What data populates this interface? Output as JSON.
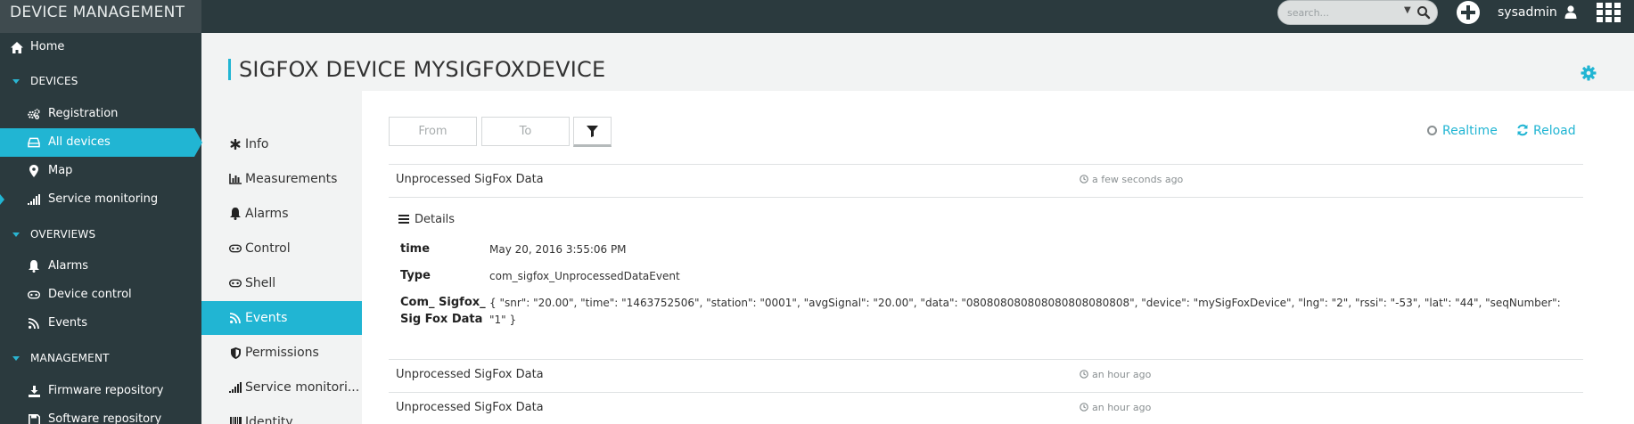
{
  "app": {
    "title": "DEVICE MANAGEMENT"
  },
  "topbar": {
    "search_placeholder": "search...",
    "username": "sysadmin"
  },
  "sidebar": {
    "home": "Home",
    "sections": {
      "devices": "DEVICES",
      "overviews": "OVERVIEWS",
      "management": "MANAGEMENT"
    },
    "devices_items": [
      "Registration",
      "All devices",
      "Map",
      "Service monitoring"
    ],
    "overviews_items": [
      "Alarms",
      "Device control",
      "Events"
    ],
    "management_items": [
      "Firmware repository",
      "Software repository"
    ],
    "active_item": "All devices"
  },
  "page": {
    "title": "SIGFOX DEVICE MYSIGFOXDEVICE"
  },
  "subnav": {
    "items": [
      "Info",
      "Measurements",
      "Alarms",
      "Control",
      "Shell",
      "Events",
      "Permissions",
      "Service monitori...",
      "Identity"
    ],
    "active_item": "Events"
  },
  "filters": {
    "from_placeholder": "From",
    "to_placeholder": "To",
    "realtime_label": "Realtime",
    "reload_label": "Reload"
  },
  "events": [
    {
      "title": "Unprocessed SigFox Data",
      "time": "a few seconds ago",
      "expanded": true
    },
    {
      "title": "Unprocessed SigFox Data",
      "time": "an hour ago",
      "expanded": false
    },
    {
      "title": "Unprocessed SigFox Data",
      "time": "an hour ago",
      "expanded": false
    }
  ],
  "details": {
    "heading": "Details",
    "rows": [
      {
        "key": "time",
        "value": "May 20, 2016 3:55:06 PM"
      },
      {
        "key": "Type",
        "value": "com_sigfox_UnprocessedDataEvent"
      },
      {
        "key_line1": "Com_ Sigfox_",
        "key_line2": "Sig Fox Data",
        "value_line1": "{ \"snr\": \"20.00\", \"time\": \"1463752506\", \"station\": \"0001\", \"avgSignal\": \"20.00\", \"data\": \"080808080808080808080808\", \"device\": \"mySigFoxDevice\", \"lng\": \"2\", \"rssi\": \"-53\", \"lat\": \"44\", \"seqNumber\":",
        "value_line2": "\"1\" }"
      }
    ]
  },
  "colors": {
    "accent": "#21b5d3",
    "topbar_bg": "#2b3a3e",
    "brand_bg": "#3f4b4f",
    "page_bg": "#f2f3f3"
  }
}
